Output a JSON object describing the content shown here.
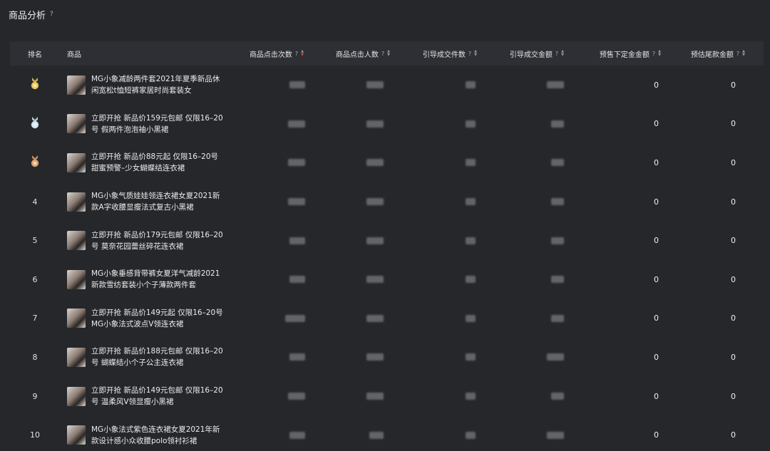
{
  "header": {
    "title": "商品分析",
    "help": "?"
  },
  "columns": {
    "rank": "排名",
    "product": "商品",
    "clicks": "商品点击次数",
    "clickers": "商品点击人数",
    "orders": "引导成交件数",
    "gmv": "引导成交金额",
    "presale_deposit": "预售下定金金额",
    "balance": "预估尾款金额"
  },
  "rows": [
    {
      "rank": "",
      "medal": "gold",
      "name": "MG小象减龄两件套2021年夏季新品休闲宽松t恤短裤家居时尚套装女",
      "deposit": "0",
      "balance": "0"
    },
    {
      "rank": "",
      "medal": "silver",
      "name": "立即开抢 新品价159元包邮 仅限16–20号 假两件泡泡袖小黑裙",
      "deposit": "0",
      "balance": "0"
    },
    {
      "rank": "",
      "medal": "bronze",
      "name": "立即开抢 新品价88元起 仅限16–20号 甜蜜预警–少女蝴蝶结连衣裙",
      "deposit": "0",
      "balance": "0"
    },
    {
      "rank": "4",
      "medal": "",
      "name": "MG小象气质娃娃领连衣裙女夏2021新款A字收腰显瘦法式复古小黑裙",
      "deposit": "0",
      "balance": "0"
    },
    {
      "rank": "5",
      "medal": "",
      "name": "立即开抢 新品价179元包邮 仅限16–20号 莫奈花园蕾丝碎花连衣裙",
      "deposit": "0",
      "balance": "0"
    },
    {
      "rank": "6",
      "medal": "",
      "name": "MG小象垂感背带裤女夏洋气减龄2021新款雪纺套装小个子薄款两件套",
      "deposit": "0",
      "balance": "0"
    },
    {
      "rank": "7",
      "medal": "",
      "name": "立即开抢 新品价149元起 仅限16–20号 MG小象法式波点V领连衣裙",
      "deposit": "0",
      "balance": "0"
    },
    {
      "rank": "8",
      "medal": "",
      "name": "立即开抢 新品价188元包邮 仅限16–20号 蝴蝶结小个子公主连衣裙",
      "deposit": "0",
      "balance": "0"
    },
    {
      "rank": "9",
      "medal": "",
      "name": "立即开抢 新品价149元包邮 仅限16–20号 温柔风V领显瘦小黑裙",
      "deposit": "0",
      "balance": "0"
    },
    {
      "rank": "10",
      "medal": "",
      "name": "MG小象法式紫色连衣裙女夏2021年新款设计感小众收腰polo领衬衫裙",
      "deposit": "0",
      "balance": "0"
    }
  ],
  "colors": {
    "background": "#26272b",
    "header_bg": "#2e2f34",
    "sort_active": "#e0454a",
    "gold": "#e8c45a",
    "silver": "#cfe3ee",
    "bronze": "#d9a06b"
  }
}
